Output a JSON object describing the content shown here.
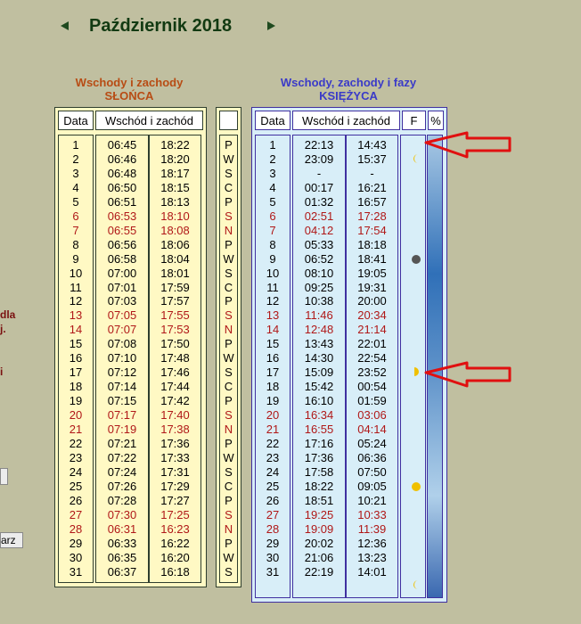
{
  "header": {
    "month": "Październik 2018"
  },
  "sun": {
    "caption_line1": "Wschody i zachody",
    "caption_line2": "SŁOŃCA",
    "col_date": "Data",
    "col_time": "Wschód i zachód",
    "rows": [
      [
        "1",
        "06:45",
        "18:22"
      ],
      [
        "2",
        "06:46",
        "18:20"
      ],
      [
        "3",
        "06:48",
        "18:17"
      ],
      [
        "4",
        "06:50",
        "18:15"
      ],
      [
        "5",
        "06:51",
        "18:13"
      ],
      [
        "6",
        "06:53",
        "18:10"
      ],
      [
        "7",
        "06:55",
        "18:08"
      ],
      [
        "8",
        "06:56",
        "18:06"
      ],
      [
        "9",
        "06:58",
        "18:04"
      ],
      [
        "10",
        "07:00",
        "18:01"
      ],
      [
        "11",
        "07:01",
        "17:59"
      ],
      [
        "12",
        "07:03",
        "17:57"
      ],
      [
        "13",
        "07:05",
        "17:55"
      ],
      [
        "14",
        "07:07",
        "17:53"
      ],
      [
        "15",
        "07:08",
        "17:50"
      ],
      [
        "16",
        "07:10",
        "17:48"
      ],
      [
        "17",
        "07:12",
        "17:46"
      ],
      [
        "18",
        "07:14",
        "17:44"
      ],
      [
        "19",
        "07:15",
        "17:42"
      ],
      [
        "20",
        "07:17",
        "17:40"
      ],
      [
        "21",
        "07:19",
        "17:38"
      ],
      [
        "22",
        "07:21",
        "17:36"
      ],
      [
        "23",
        "07:22",
        "17:33"
      ],
      [
        "24",
        "07:24",
        "17:31"
      ],
      [
        "25",
        "07:26",
        "17:29"
      ],
      [
        "26",
        "07:28",
        "17:27"
      ],
      [
        "27",
        "07:30",
        "17:25"
      ],
      [
        "28",
        "06:31",
        "16:23"
      ],
      [
        "29",
        "06:33",
        "16:22"
      ],
      [
        "30",
        "06:35",
        "16:20"
      ],
      [
        "31",
        "06:37",
        "16:18"
      ]
    ]
  },
  "weekdays": [
    "P",
    "W",
    "S",
    "C",
    "P",
    "S",
    "N",
    "P",
    "W",
    "S",
    "C",
    "P",
    "S",
    "N",
    "P",
    "W",
    "S",
    "C",
    "P",
    "S",
    "N",
    "P",
    "W",
    "S",
    "C",
    "P",
    "S",
    "N",
    "P",
    "W",
    "S"
  ],
  "moon": {
    "caption_line1": "Wschody, zachody i fazy",
    "caption_line2": "KSIĘŻYCA",
    "col_date": "Data",
    "col_time": "Wschód i zachód",
    "col_phase": "F",
    "col_pct": "%",
    "rows": [
      [
        "1",
        "22:13",
        "14:43"
      ],
      [
        "2",
        "23:09",
        "15:37"
      ],
      [
        "3",
        "-",
        "-"
      ],
      [
        "4",
        "00:17",
        "16:21"
      ],
      [
        "5",
        "01:32",
        "16:57"
      ],
      [
        "6",
        "02:51",
        "17:28"
      ],
      [
        "7",
        "04:12",
        "17:54"
      ],
      [
        "8",
        "05:33",
        "18:18"
      ],
      [
        "9",
        "06:52",
        "18:41"
      ],
      [
        "10",
        "08:10",
        "19:05"
      ],
      [
        "11",
        "09:25",
        "19:31"
      ],
      [
        "12",
        "10:38",
        "20:00"
      ],
      [
        "13",
        "11:46",
        "20:34"
      ],
      [
        "14",
        "12:48",
        "21:14"
      ],
      [
        "15",
        "13:43",
        "22:01"
      ],
      [
        "16",
        "14:30",
        "22:54"
      ],
      [
        "17",
        "15:09",
        "23:52"
      ],
      [
        "18",
        "15:42",
        "00:54"
      ],
      [
        "19",
        "16:10",
        "01:59"
      ],
      [
        "20",
        "16:34",
        "03:06"
      ],
      [
        "21",
        "16:55",
        "04:14"
      ],
      [
        "22",
        "17:16",
        "05:24"
      ],
      [
        "23",
        "17:36",
        "06:36"
      ],
      [
        "24",
        "17:58",
        "07:50"
      ],
      [
        "25",
        "18:22",
        "09:05"
      ],
      [
        "26",
        "18:51",
        "10:21"
      ],
      [
        "27",
        "19:25",
        "10:33"
      ],
      [
        "28",
        "19:09",
        "11:39"
      ],
      [
        "29",
        "20:02",
        "12:36"
      ],
      [
        "30",
        "21:06",
        "13:23"
      ],
      [
        "31",
        "22:19",
        "14:01"
      ]
    ]
  },
  "red_days": [
    "6",
    "7",
    "13",
    "14",
    "20",
    "21",
    "27",
    "28"
  ],
  "phases": [
    {
      "day": 2,
      "kind": "waning-crescent"
    },
    {
      "day": 9,
      "kind": "new"
    },
    {
      "day": 17,
      "kind": "first-quarter"
    },
    {
      "day": 25,
      "kind": "full"
    },
    {
      "day": 32,
      "kind": "waning-crescent"
    }
  ],
  "left_fragments": {
    "line1": "dla",
    "line2": "j.",
    "line3": "i"
  },
  "left_button_label": "arz",
  "colors": {
    "phase_yellow": "#f0c000",
    "new_moon": "#555555",
    "arrow_red": "#e01010"
  }
}
